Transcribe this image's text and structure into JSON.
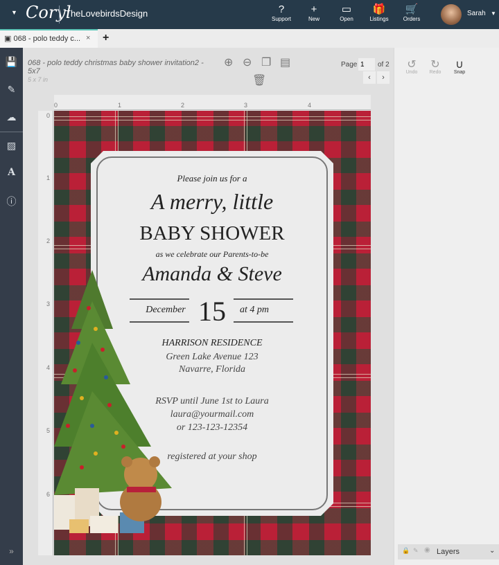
{
  "topbar": {
    "logo": "Coryl",
    "shop": "TheLovebirdsDesign",
    "nav": [
      {
        "label": "Support",
        "icon": "question-circle-icon",
        "glyph": "?"
      },
      {
        "label": "New",
        "icon": "new-file-icon",
        "glyph": "+"
      },
      {
        "label": "Open",
        "icon": "folder-icon",
        "glyph": "▭"
      },
      {
        "label": "Listings",
        "icon": "gift-icon",
        "glyph": "🎁"
      },
      {
        "label": "Orders",
        "icon": "cart-icon",
        "glyph": "🛒"
      }
    ],
    "user": "Sarah"
  },
  "tab": {
    "label": "068 - polo teddy c...",
    "close": "×",
    "add": "+"
  },
  "doc": {
    "title": "068 - polo teddy christmas baby shower invitation2 - 5x7",
    "size": "5 x 7 in",
    "page_label": "Page",
    "page": "1",
    "page_of": "of 2"
  },
  "right": {
    "undo": "Undo",
    "redo": "Redo",
    "snap": "Snap",
    "layers": "Layers"
  },
  "ruler": {
    "top": [
      "0",
      "1",
      "2",
      "3",
      "4"
    ],
    "left": [
      "0",
      "1",
      "2",
      "3",
      "4",
      "5",
      "6"
    ]
  },
  "card": {
    "intro": "Please join us for a",
    "script1": "A merry, little",
    "headline": "BABY SHOWER",
    "sub": "as we celebrate our Parents-to-be",
    "names": "Amanda & Steve",
    "month": "December",
    "day": "15",
    "time": "at 4 pm",
    "venue": "HARRISON RESIDENCE",
    "street": "Green Lake Avenue 123",
    "city": "Navarre, Florida",
    "rsvp": "RSVP until June 1st to Laura",
    "email": "laura@yourmail.com",
    "phone": "or 123-123-12354",
    "registry": "registered at your shop"
  },
  "colors": {
    "topbar": "#263a4a",
    "sidebar": "#343d4a",
    "plaid_red": "#b8213a",
    "plaid_green": "#3a4a3c",
    "accent": "#5ec6b8"
  }
}
